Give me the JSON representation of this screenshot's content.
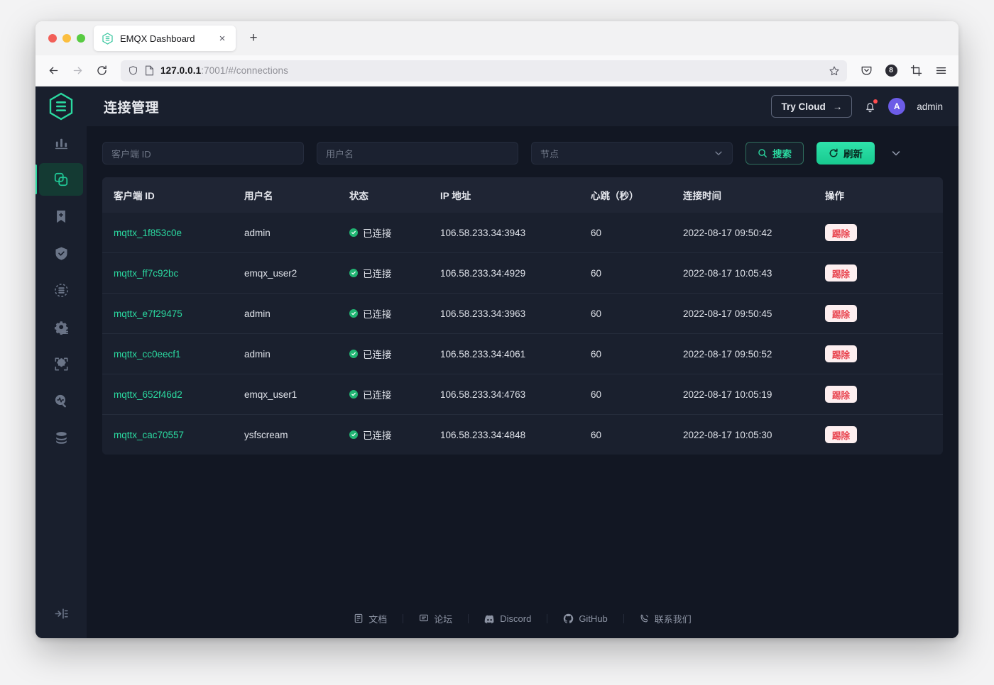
{
  "browser": {
    "tab_title": "EMQX Dashboard",
    "tab_favicon": "emqx-hex-icon",
    "close_label": "×",
    "newtab_label": "+",
    "url_host": "127.0.0.1",
    "url_rest": ":7001/#/connections",
    "back_icon": "back-arrow-icon",
    "forward_icon": "forward-arrow-icon",
    "reload_icon": "reload-icon",
    "shield_icon": "shield-icon",
    "page-icon": "page-icon",
    "bookmark_icon": "star-icon",
    "pocket_icon": "pocket-icon",
    "account_badge": "8",
    "screenshot_icon": "crop-icon",
    "menu_icon": "hamburger-menu-icon"
  },
  "sidebar": {
    "logo": "emqx-hexagon-logo",
    "items": [
      {
        "name": "monitoring",
        "icon": "chart-bar-icon",
        "active": false
      },
      {
        "name": "connections",
        "icon": "connection-icon",
        "active": true
      },
      {
        "name": "retained",
        "icon": "bookmark-plus-icon",
        "active": false
      },
      {
        "name": "access-control",
        "icon": "shield-check-icon",
        "active": false
      },
      {
        "name": "data-integration",
        "icon": "database-stack-icon",
        "active": false
      },
      {
        "name": "rules",
        "icon": "gear-layers-icon",
        "active": false
      },
      {
        "name": "extensions",
        "icon": "puzzle-piece-icon",
        "active": false
      },
      {
        "name": "diagnose",
        "icon": "magnifier-pulse-icon",
        "active": false
      },
      {
        "name": "management",
        "icon": "layers-icon",
        "active": false
      }
    ],
    "collapse_icon": "collapse-sidebar-icon"
  },
  "header": {
    "title": "连接管理",
    "try_cloud_label": "Try Cloud",
    "try_cloud_arrow": "→",
    "bell_icon": "bell-notification-icon",
    "avatar_initial": "A",
    "user_name": "admin"
  },
  "filters": {
    "client_id_placeholder": "客户端 ID",
    "client_id_value": "",
    "username_placeholder": "用户名",
    "username_value": "",
    "node_placeholder": "节点",
    "node_value": "",
    "search_label": "搜索",
    "search_icon": "search-icon",
    "refresh_label": "刷新",
    "refresh_icon": "refresh-icon",
    "more_icon": "chevron-down-icon"
  },
  "table": {
    "columns": [
      "客户端 ID",
      "用户名",
      "状态",
      "IP 地址",
      "心跳（秒）",
      "连接时间",
      "操作"
    ],
    "action_label": "踢除",
    "rows": [
      {
        "client_id": "mqttx_1f853c0e",
        "username": "admin",
        "status": "已连接",
        "ip": "106.58.233.34:3943",
        "keepalive": "60",
        "connected_at": "2022-08-17 09:50:42"
      },
      {
        "client_id": "mqttx_ff7c92bc",
        "username": "emqx_user2",
        "status": "已连接",
        "ip": "106.58.233.34:4929",
        "keepalive": "60",
        "connected_at": "2022-08-17 10:05:43"
      },
      {
        "client_id": "mqttx_e7f29475",
        "username": "admin",
        "status": "已连接",
        "ip": "106.58.233.34:3963",
        "keepalive": "60",
        "connected_at": "2022-08-17 09:50:45"
      },
      {
        "client_id": "mqttx_cc0eecf1",
        "username": "admin",
        "status": "已连接",
        "ip": "106.58.233.34:4061",
        "keepalive": "60",
        "connected_at": "2022-08-17 09:50:52"
      },
      {
        "client_id": "mqttx_652f46d2",
        "username": "emqx_user1",
        "status": "已连接",
        "ip": "106.58.233.34:4763",
        "keepalive": "60",
        "connected_at": "2022-08-17 10:05:19"
      },
      {
        "client_id": "mqttx_cac70557",
        "username": "ysfscream",
        "status": "已连接",
        "ip": "106.58.233.34:4848",
        "keepalive": "60",
        "connected_at": "2022-08-17 10:05:30"
      }
    ]
  },
  "footer": {
    "links": [
      {
        "label": "文档",
        "icon": "document-icon"
      },
      {
        "label": "论坛",
        "icon": "comment-icon"
      },
      {
        "label": "Discord",
        "icon": "discord-icon"
      },
      {
        "label": "GitHub",
        "icon": "github-icon"
      },
      {
        "label": "联系我们",
        "icon": "phone-icon"
      }
    ]
  },
  "colors": {
    "accent_green": "#2bd9a0",
    "status_green": "#21b573",
    "danger_red": "#e8414c",
    "app_bg": "#121723",
    "panel_bg": "#1a202e",
    "sidebar_bg": "#191f2d",
    "avatar_purple": "#6c5ce7"
  }
}
